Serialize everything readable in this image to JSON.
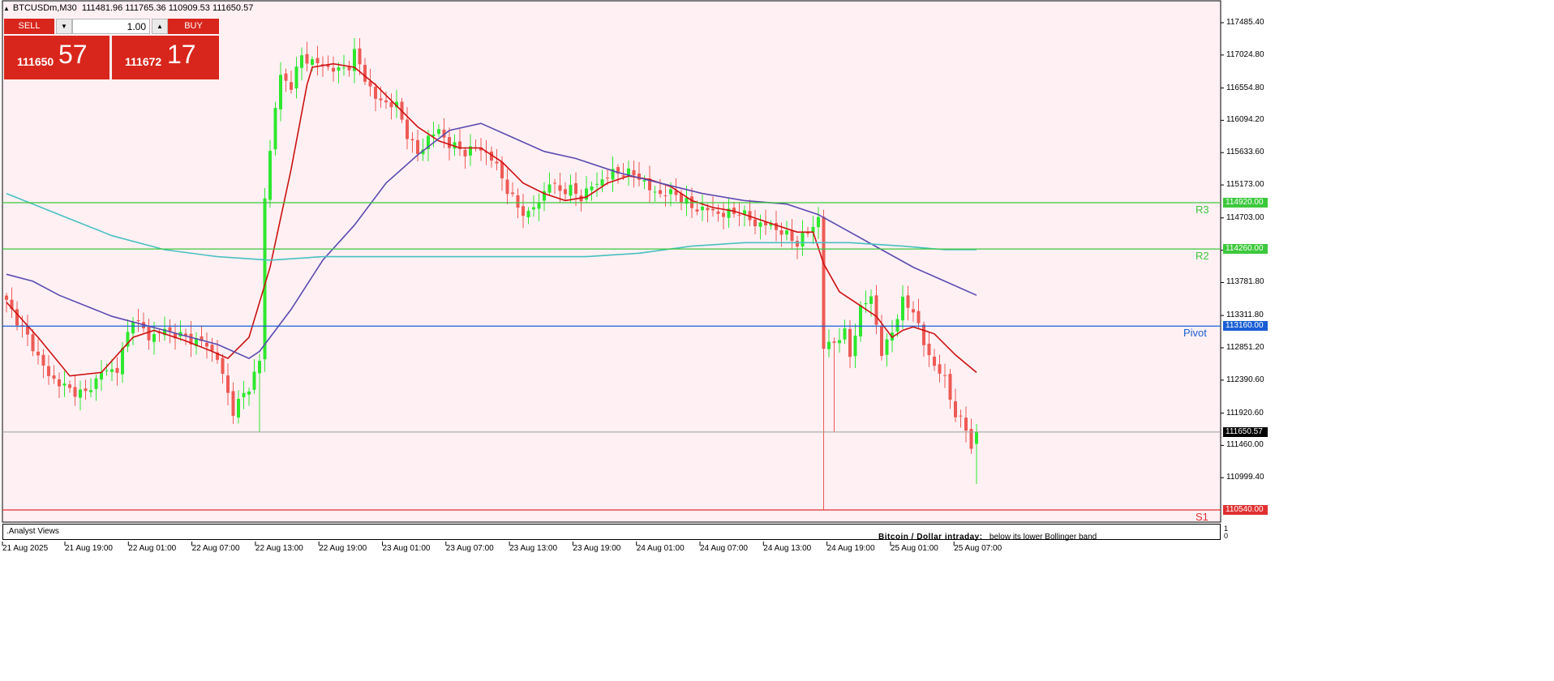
{
  "header": {
    "symbol_tf": "BTCUSDm,M30",
    "ohlc": "111481.96 111765.36 110909.53 111650.57"
  },
  "trade_panel": {
    "sell_label": "SELL",
    "buy_label": "BUY",
    "lot": "1.00",
    "bid_small": "111650",
    "bid_big": "57",
    "ask_small": "111672",
    "ask_big": "17",
    "down_arrow_icon": "chevron-down-icon",
    "up_arrow_icon": "chevron-up-icon"
  },
  "colors": {
    "background": "#fff0f4",
    "bull": "#2ee82e",
    "bear": "#ee5a55",
    "ma_fast": "#cc1111",
    "ma_mid": "#5c4bb0",
    "ma_slow": "#48c0c0",
    "resistance": "#3cc83c",
    "pivot": "#1a5fd4",
    "support": "#e03030",
    "price_line": "#9aa09a"
  },
  "chart_data": {
    "type": "candlestick",
    "symbol": "BTCUSDm",
    "timeframe": "M30",
    "ylim": [
      110540,
      117700
    ],
    "yticks": [
      "117485.40",
      "117024.80",
      "116554.80",
      "116094.20",
      "115633.60",
      "115173.00",
      "114703.00",
      "114242.40",
      "113781.80",
      "113311.80",
      "112851.20",
      "112390.60",
      "111920.60",
      "111460.00",
      "110999.40"
    ],
    "xticks": [
      "21 Aug 2025",
      "21 Aug 19:00",
      "22 Aug 01:00",
      "22 Aug 07:00",
      "22 Aug 13:00",
      "22 Aug 19:00",
      "23 Aug 01:00",
      "23 Aug 07:00",
      "23 Aug 13:00",
      "23 Aug 19:00",
      "24 Aug 01:00",
      "24 Aug 07:00",
      "24 Aug 13:00",
      "24 Aug 19:00",
      "25 Aug 01:00",
      "25 Aug 07:00"
    ],
    "bars_total": 195,
    "current_price": "111650.57",
    "levels": [
      {
        "name": "R3",
        "value": 114920.0,
        "label": "114920.00"
      },
      {
        "name": "R2",
        "value": 114260.0,
        "label": "114260.00"
      },
      {
        "name": "Pivot",
        "value": 113160.0,
        "label": "113160.00"
      },
      {
        "name": "S1",
        "value": 110540.0,
        "label": "110540.00"
      }
    ],
    "anchor_closes": [
      [
        0,
        113500
      ],
      [
        4,
        113000
      ],
      [
        8,
        112450
      ],
      [
        12,
        112250
      ],
      [
        15,
        112200
      ],
      [
        18,
        112500
      ],
      [
        21,
        112550
      ],
      [
        24,
        113300
      ],
      [
        27,
        113000
      ],
      [
        30,
        113100
      ],
      [
        34,
        113000
      ],
      [
        38,
        112900
      ],
      [
        40,
        112700
      ],
      [
        43,
        111950
      ],
      [
        46,
        112300
      ],
      [
        48,
        112650
      ],
      [
        49,
        115000
      ],
      [
        51,
        116300
      ],
      [
        52,
        116700
      ],
      [
        54,
        116600
      ],
      [
        56,
        117000
      ],
      [
        59,
        116900
      ],
      [
        61,
        116850
      ],
      [
        63,
        116800
      ],
      [
        65,
        116880
      ],
      [
        66,
        117050
      ],
      [
        68,
        116700
      ],
      [
        70,
        116400
      ],
      [
        74,
        116300
      ],
      [
        76,
        115900
      ],
      [
        78,
        115600
      ],
      [
        80,
        115850
      ],
      [
        82,
        115950
      ],
      [
        84,
        115750
      ],
      [
        87,
        115650
      ],
      [
        90,
        115700
      ],
      [
        93,
        115450
      ],
      [
        95,
        115100
      ],
      [
        97,
        114850
      ],
      [
        99,
        114750
      ],
      [
        101,
        114950
      ],
      [
        103,
        115200
      ],
      [
        105,
        115100
      ],
      [
        107,
        115100
      ],
      [
        109,
        115000
      ],
      [
        111,
        115150
      ],
      [
        113,
        115250
      ],
      [
        115,
        115350
      ],
      [
        117,
        115350
      ],
      [
        120,
        115300
      ],
      [
        122,
        115100
      ],
      [
        124,
        115050
      ],
      [
        127,
        115050
      ],
      [
        130,
        114850
      ],
      [
        133,
        114820
      ],
      [
        136,
        114750
      ],
      [
        139,
        114800
      ],
      [
        142,
        114620
      ],
      [
        145,
        114600
      ],
      [
        148,
        114450
      ],
      [
        150,
        114350
      ],
      [
        152,
        114500
      ],
      [
        154,
        114700
      ],
      [
        155,
        112850
      ],
      [
        157,
        112950
      ],
      [
        159,
        113050
      ],
      [
        160,
        112750
      ],
      [
        162,
        113400
      ],
      [
        164,
        113600
      ],
      [
        166,
        112750
      ],
      [
        168,
        113100
      ],
      [
        170,
        113500
      ],
      [
        172,
        113400
      ],
      [
        174,
        112900
      ],
      [
        176,
        112600
      ],
      [
        178,
        112400
      ],
      [
        180,
        111900
      ],
      [
        182,
        111700
      ],
      [
        183,
        111450
      ],
      [
        184,
        111650
      ]
    ],
    "series": [
      {
        "name": "",
        "type": "moving_average",
        "points": [
          [
            0,
            113500
          ],
          [
            6,
            113000
          ],
          [
            12,
            112450
          ],
          [
            18,
            112500
          ],
          [
            24,
            113000
          ],
          [
            28,
            113100
          ],
          [
            34,
            112950
          ],
          [
            39,
            112800
          ],
          [
            42,
            112700
          ],
          [
            46,
            113000
          ],
          [
            50,
            114000
          ],
          [
            54,
            115400
          ],
          [
            57,
            116600
          ],
          [
            58,
            116850
          ],
          [
            62,
            116900
          ],
          [
            66,
            116850
          ],
          [
            70,
            116600
          ],
          [
            74,
            116300
          ],
          [
            78,
            116000
          ],
          [
            82,
            115800
          ],
          [
            86,
            115700
          ],
          [
            90,
            115700
          ],
          [
            94,
            115500
          ],
          [
            98,
            115200
          ],
          [
            102,
            115050
          ],
          [
            106,
            114950
          ],
          [
            110,
            115000
          ],
          [
            114,
            115200
          ],
          [
            118,
            115300
          ],
          [
            122,
            115250
          ],
          [
            126,
            115150
          ],
          [
            130,
            114950
          ],
          [
            134,
            114850
          ],
          [
            138,
            114800
          ],
          [
            142,
            114700
          ],
          [
            146,
            114600
          ],
          [
            150,
            114500
          ],
          [
            153,
            114500
          ],
          [
            155,
            114050
          ],
          [
            158,
            113650
          ],
          [
            162,
            113450
          ],
          [
            165,
            113300
          ],
          [
            168,
            113000
          ],
          [
            170,
            113100
          ],
          [
            172,
            113150
          ],
          [
            176,
            113050
          ],
          [
            180,
            112750
          ],
          [
            184,
            112500
          ]
        ]
      },
      {
        "name": "",
        "type": "moving_average",
        "points": [
          [
            0,
            113900
          ],
          [
            5,
            113800
          ],
          [
            10,
            113600
          ],
          [
            20,
            113300
          ],
          [
            30,
            113100
          ],
          [
            40,
            112900
          ],
          [
            46,
            112700
          ],
          [
            48,
            112800
          ],
          [
            54,
            113400
          ],
          [
            60,
            114100
          ],
          [
            66,
            114600
          ],
          [
            72,
            115200
          ],
          [
            78,
            115600
          ],
          [
            84,
            115950
          ],
          [
            90,
            116050
          ],
          [
            96,
            115850
          ],
          [
            102,
            115650
          ],
          [
            108,
            115550
          ],
          [
            116,
            115350
          ],
          [
            124,
            115200
          ],
          [
            132,
            115050
          ],
          [
            140,
            114950
          ],
          [
            148,
            114900
          ],
          [
            154,
            114750
          ],
          [
            160,
            114500
          ],
          [
            166,
            114250
          ],
          [
            172,
            114000
          ],
          [
            178,
            113800
          ],
          [
            184,
            113600
          ]
        ]
      },
      {
        "name": "",
        "type": "moving_average",
        "points": [
          [
            0,
            115050
          ],
          [
            10,
            114750
          ],
          [
            20,
            114450
          ],
          [
            30,
            114250
          ],
          [
            40,
            114150
          ],
          [
            50,
            114100
          ],
          [
            60,
            114150
          ],
          [
            70,
            114150
          ],
          [
            80,
            114150
          ],
          [
            90,
            114150
          ],
          [
            100,
            114150
          ],
          [
            110,
            114150
          ],
          [
            120,
            114200
          ],
          [
            130,
            114300
          ],
          [
            140,
            114350
          ],
          [
            150,
            114350
          ],
          [
            160,
            114350
          ],
          [
            170,
            114300
          ],
          [
            178,
            114250
          ],
          [
            184,
            114250
          ]
        ]
      }
    ]
  },
  "subwindow": {
    "title": ".Analyst Views",
    "scale_top": "1",
    "scale_bottom": "0",
    "analyst_label": "Bitcoin / Dollar intraday:",
    "analyst_text": "below its lower Bollinger band"
  }
}
